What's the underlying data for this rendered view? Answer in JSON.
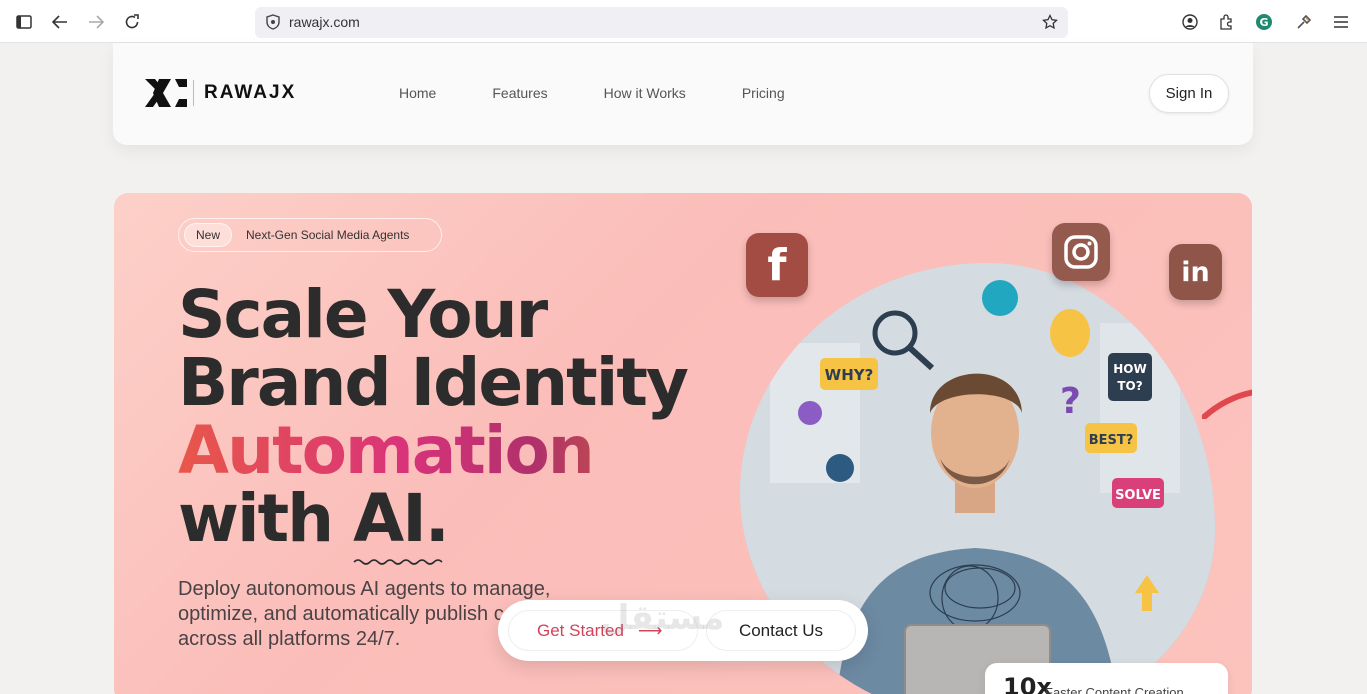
{
  "browser": {
    "url": "rawajx.com"
  },
  "nav": {
    "brand": "RAWAJX",
    "links": [
      "Home",
      "Features",
      "How it Works",
      "Pricing"
    ],
    "signin_label": "Sign In"
  },
  "hero": {
    "badge_new": "New",
    "badge_text": "Next-Gen Social Media Agents",
    "headline_line1": "Scale Your",
    "headline_line2": "Brand Identity",
    "headline_gradient": "Automation",
    "headline_line4_prefix": "with ",
    "headline_ai": "AI",
    "headline_period": ".",
    "subcopy": "Deploy autonomous AI agents to manage, optimize, and automatically publish content across all platforms 24/7.",
    "social_icons": [
      "facebook-icon",
      "instagram-icon",
      "linkedin-icon"
    ],
    "stat_value": "10x",
    "stat_label": "Faster Content Creation",
    "colors": {
      "hero_bg": "#fbbdb9",
      "gradient_start": "#e8574a",
      "gradient_mid": "#d9337a",
      "gradient_end": "#cd6a2f"
    }
  },
  "cta": {
    "get_started_label": "Get Started",
    "contact_label": "Contact Us"
  },
  "watermark": "مستقل"
}
